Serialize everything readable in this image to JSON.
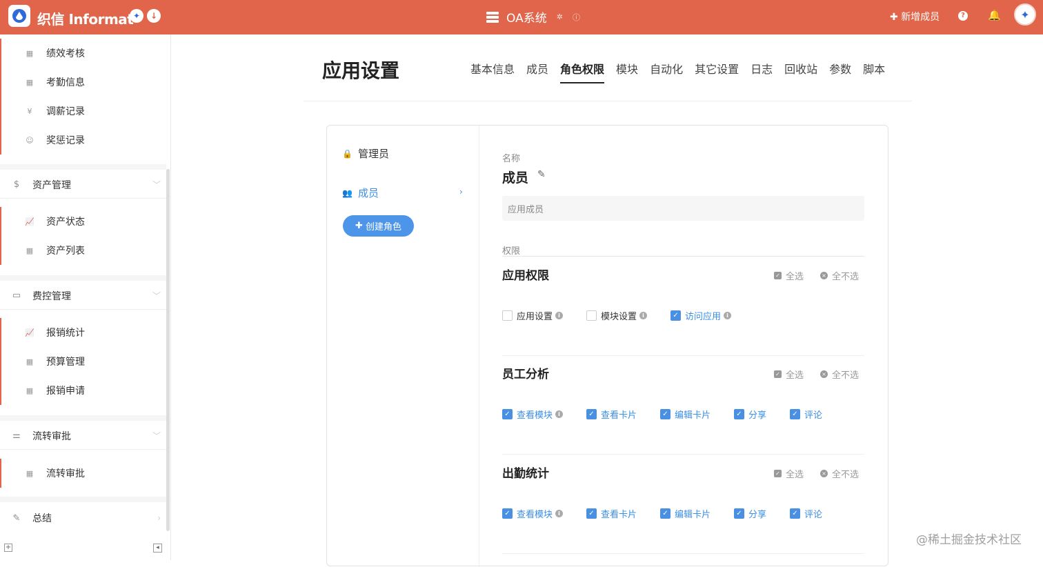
{
  "topbar": {
    "brand": "织信 Informat",
    "center_title": "OA系统",
    "add_member": "新增成员"
  },
  "sidebar": {
    "group1_items": [
      {
        "label": "绩效考核",
        "icon": "table-icon"
      },
      {
        "label": "考勤信息",
        "icon": "table-icon"
      },
      {
        "label": "调薪记录",
        "icon": "yen-icon"
      },
      {
        "label": "奖惩记录",
        "icon": "smile-icon"
      }
    ],
    "groups": [
      {
        "label": "资产管理",
        "icon": "dollar-icon",
        "items": [
          {
            "label": "资产状态",
            "icon": "line-chart-icon"
          },
          {
            "label": "资产列表",
            "icon": "table-icon"
          }
        ]
      },
      {
        "label": "费控管理",
        "icon": "money-icon",
        "items": [
          {
            "label": "报销统计",
            "icon": "line-chart-icon"
          },
          {
            "label": "预算管理",
            "icon": "table-icon"
          },
          {
            "label": "报销申请",
            "icon": "table-icon"
          }
        ]
      },
      {
        "label": "流转审批",
        "icon": "filter-icon",
        "items": [
          {
            "label": "流转审批",
            "icon": "table-icon"
          }
        ]
      }
    ],
    "summary": "总结"
  },
  "page": {
    "title": "应用设置",
    "tabs": [
      "基本信息",
      "成员",
      "角色权限",
      "模块",
      "自动化",
      "其它设置",
      "日志",
      "回收站",
      "参数",
      "脚本"
    ],
    "active_tab": "角色权限"
  },
  "roles": {
    "admin": "管理员",
    "member": "成员",
    "create": "创建角色"
  },
  "detail": {
    "name_label": "名称",
    "name": "成员",
    "desc": "应用成员",
    "perm_label": "权限",
    "select_all": "全选",
    "select_none": "全不选",
    "sections": [
      {
        "title": "应用权限",
        "perms": [
          {
            "label": "应用设置",
            "checked": false,
            "info": true
          },
          {
            "label": "模块设置",
            "checked": false,
            "info": true
          },
          {
            "label": "访问应用",
            "checked": true,
            "info": true
          }
        ]
      },
      {
        "title": "员工分析",
        "perms": [
          {
            "label": "查看模块",
            "checked": true,
            "info": true
          },
          {
            "label": "查看卡片",
            "checked": true,
            "info": false
          },
          {
            "label": "编辑卡片",
            "checked": true,
            "info": false
          },
          {
            "label": "分享",
            "checked": true,
            "info": false
          },
          {
            "label": "评论",
            "checked": true,
            "info": false
          }
        ]
      },
      {
        "title": "出勤统计",
        "perms": [
          {
            "label": "查看模块",
            "checked": true,
            "info": true
          },
          {
            "label": "查看卡片",
            "checked": true,
            "info": false
          },
          {
            "label": "编辑卡片",
            "checked": true,
            "info": false
          },
          {
            "label": "分享",
            "checked": true,
            "info": false
          },
          {
            "label": "评论",
            "checked": true,
            "info": false
          }
        ]
      }
    ]
  },
  "watermark": "@稀土掘金技术社区",
  "colors": {
    "brand": "#e0654a",
    "accent": "#4a90e2"
  }
}
